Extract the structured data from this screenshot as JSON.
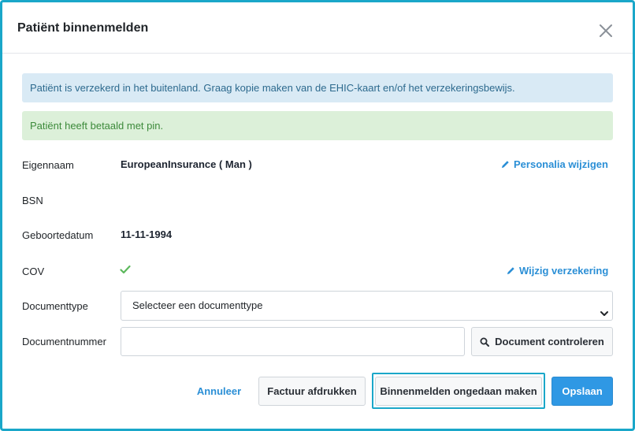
{
  "modal": {
    "title": "Patiënt binnenmelden",
    "close_icon": "close-icon"
  },
  "alerts": {
    "info": "Patiënt is verzekerd in het buitenland. Graag kopie maken van de EHIC-kaart en/of het verzekeringsbewijs.",
    "success": "Patiënt heeft betaald met pin."
  },
  "fields": {
    "eigennaam_label": "Eigennaam",
    "eigennaam_value": "EuropeanInsurance ( Man )",
    "bsn_label": "BSN",
    "bsn_value": "",
    "geboortedatum_label": "Geboortedatum",
    "geboortedatum_value": "11-11-1994",
    "cov_label": "COV",
    "cov_icon": "check-icon",
    "documenttype_label": "Documenttype",
    "documenttype_value": "Selecteer een documenttype",
    "documentnummer_label": "Documentnummer",
    "documentnummer_value": ""
  },
  "links": {
    "personalia": "Personalia wijzigen",
    "verzekering": "Wijzig verzekering"
  },
  "buttons": {
    "document_controleren": "Document controleren",
    "annuleer": "Annuleer",
    "factuur": "Factuur afdrukken",
    "ongedaan": "Binnenmelden ongedaan maken",
    "opslaan": "Opslaan"
  },
  "colors": {
    "accent": "#2f98e4",
    "highlight": "#1aa7c9",
    "info_bg": "#d9eaf5",
    "success_bg": "#dcf0d9",
    "check": "#5cb85c"
  }
}
